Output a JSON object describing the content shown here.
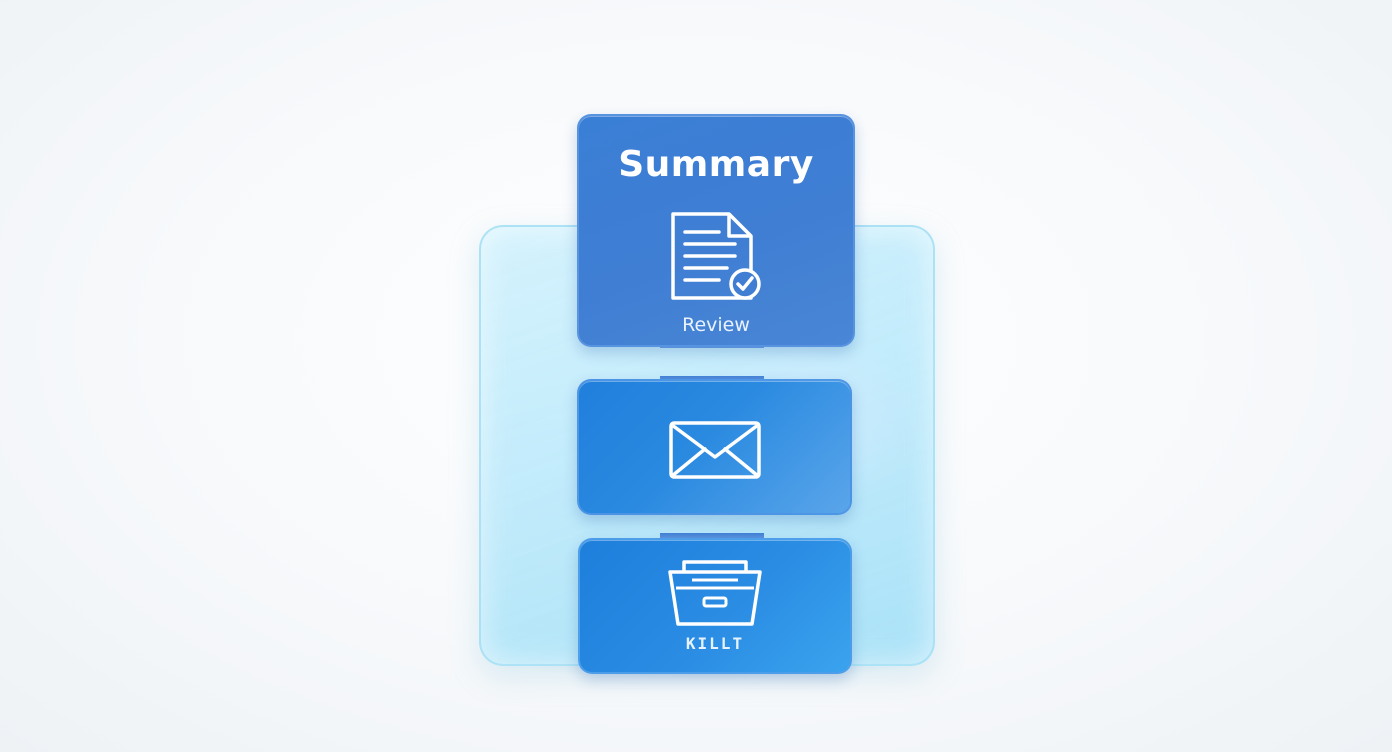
{
  "stack": {
    "top_card": {
      "title": "Summary",
      "caption": "Review",
      "icon": "document-check-icon"
    },
    "middle_card": {
      "icon": "envelope-icon"
    },
    "bottom_card": {
      "icon": "archive-drawer-icon",
      "caption": "KILLT"
    },
    "colors": {
      "card_blue": "#3a7fd6",
      "card_bright_blue": "#1f7fdc",
      "panel_cyan": "#aae4fa",
      "icon_stroke": "#ffffff"
    }
  }
}
